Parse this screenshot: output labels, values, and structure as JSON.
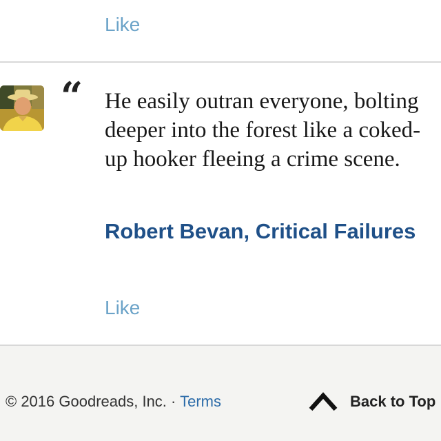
{
  "previous_quote": {
    "like_label": "Like"
  },
  "quote": {
    "open_quote_glyph": "“",
    "text": "He easily outran everyone, bolting deeper into the forest like a coked-up hooker fleeing a crime scene.",
    "author": "Robert Bevan",
    "separator": ",",
    "book": "Critical Failures",
    "like_label": "Like"
  },
  "footer": {
    "copyright": "© 2016 Goodreads, Inc. ·",
    "terms_label": "Terms",
    "back_to_top_label": "Back to Top",
    "back_to_top_icon": "chevron-up-icon"
  },
  "colors": {
    "link_light": "#6ba3c8",
    "author_link": "#1f5088",
    "terms_link": "#2a6aa8",
    "footer_bg": "#f4f4f2",
    "divider": "#d8d8d8"
  }
}
